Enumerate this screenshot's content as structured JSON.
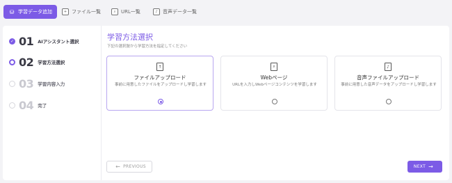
{
  "tabs": [
    {
      "label": "学習データ追加",
      "icon": "database-add-icon",
      "active": true
    },
    {
      "label": "ファイル一覧",
      "icon": "file-icon",
      "active": false
    },
    {
      "label": "URL一覧",
      "icon": "url-search-icon",
      "active": false
    },
    {
      "label": "音声データ一覧",
      "icon": "audio-file-icon",
      "active": false
    }
  ],
  "steps": [
    {
      "num": "01",
      "label": "AIアシスタント選択",
      "state": "done"
    },
    {
      "num": "02",
      "label": "学習方法選択",
      "state": "current"
    },
    {
      "num": "03",
      "label": "学習内容入力",
      "state": "todo"
    },
    {
      "num": "04",
      "label": "完了",
      "state": "todo"
    }
  ],
  "content": {
    "title": "学習方法選択",
    "subtitle": "下記の選択肢から学習方法を指定してください"
  },
  "options": [
    {
      "title": "ファイルアップロード",
      "desc": "事前に用意したファイルをアップロードし学習します",
      "icon": "upload-file-icon",
      "selected": true
    },
    {
      "title": "Webページ",
      "desc": "URLを入力しWebページコンテンツを学習します",
      "icon": "web-search-icon",
      "selected": false
    },
    {
      "title": "音声ファイルアップロード",
      "desc": "事前に用意した音声データをアップロードし学習します",
      "icon": "audio-upload-icon",
      "selected": false
    }
  ],
  "buttons": {
    "previous": "PREVIOUS",
    "next": "NEXT"
  },
  "colors": {
    "accent": "#7c5be6"
  }
}
